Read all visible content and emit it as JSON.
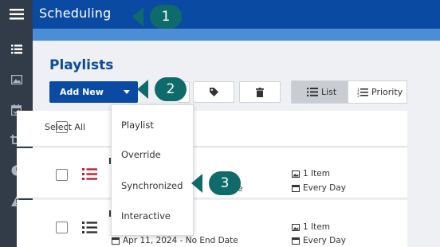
{
  "app": {
    "title": "Scheduling"
  },
  "page": {
    "title": "Playlists"
  },
  "toolbar": {
    "add_new_label": "Add New",
    "view_list_label": "List",
    "view_priority_label": "Priority"
  },
  "table": {
    "select_all_label": "Select All"
  },
  "add_new_menu": {
    "items": [
      "Playlist",
      "Override",
      "Synchronized",
      "Interactive"
    ]
  },
  "rows": [
    {
      "name_initial": "F",
      "items": "1 Item",
      "schedule": "Every Day",
      "date_partial": "te"
    },
    {
      "name_initial": "H",
      "items": "1 Item",
      "schedule": "Every Day",
      "date_range": "Apr 11, 2024 - No End Date"
    }
  ],
  "callouts": [
    "1",
    "2",
    "3"
  ],
  "colors": {
    "header_blue": "#0b4aa3",
    "subheader_blue": "#4b8ed6",
    "rail": "#323c48",
    "callout": "#0f6b6a",
    "list_icon_red": "#c3202b"
  }
}
